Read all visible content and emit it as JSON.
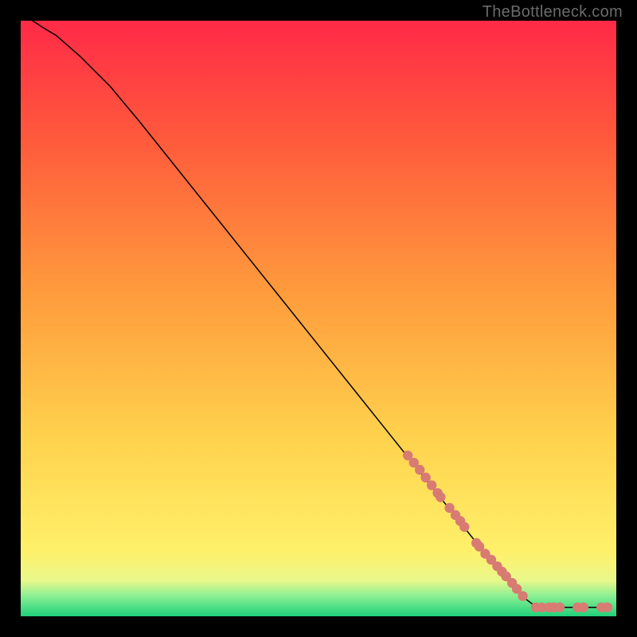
{
  "watermark": "TheBottleneck.com",
  "chart_data": {
    "type": "scatter",
    "title": "",
    "xlabel": "",
    "ylabel": "",
    "xlim": [
      0,
      100
    ],
    "ylim": [
      0,
      100
    ],
    "background_gradient": {
      "stops": [
        {
          "pct": 0.0,
          "color": "#1fd17b"
        },
        {
          "pct": 0.035,
          "color": "#8ef093"
        },
        {
          "pct": 0.06,
          "color": "#e9f88a"
        },
        {
          "pct": 0.11,
          "color": "#fff06a"
        },
        {
          "pct": 0.3,
          "color": "#ffd24d"
        },
        {
          "pct": 0.55,
          "color": "#ff9a3c"
        },
        {
          "pct": 0.8,
          "color": "#ff5a3c"
        },
        {
          "pct": 1.0,
          "color": "#ff2a47"
        }
      ]
    },
    "series": [
      {
        "name": "curve",
        "kind": "line",
        "color": "#000000",
        "width": 1.5,
        "points": [
          {
            "x": 2.0,
            "y": 100.0
          },
          {
            "x": 3.5,
            "y": 99.0
          },
          {
            "x": 6.0,
            "y": 97.5
          },
          {
            "x": 10.0,
            "y": 94.0
          },
          {
            "x": 15.0,
            "y": 89.0
          },
          {
            "x": 20.0,
            "y": 83.0
          },
          {
            "x": 30.0,
            "y": 70.5
          },
          {
            "x": 40.0,
            "y": 58.0
          },
          {
            "x": 50.0,
            "y": 45.5
          },
          {
            "x": 60.0,
            "y": 33.0
          },
          {
            "x": 70.0,
            "y": 20.5
          },
          {
            "x": 78.0,
            "y": 10.5
          },
          {
            "x": 84.0,
            "y": 3.5
          },
          {
            "x": 86.0,
            "y": 2.0
          },
          {
            "x": 88.0,
            "y": 1.5
          },
          {
            "x": 92.0,
            "y": 1.5
          },
          {
            "x": 96.0,
            "y": 1.5
          },
          {
            "x": 99.0,
            "y": 1.5
          }
        ]
      },
      {
        "name": "markers",
        "kind": "scatter",
        "color": "#d77b73",
        "radius": 6.2,
        "points": [
          {
            "x": 65.0,
            "y": 27.0
          },
          {
            "x": 66.0,
            "y": 25.8
          },
          {
            "x": 67.0,
            "y": 24.6
          },
          {
            "x": 68.0,
            "y": 23.3
          },
          {
            "x": 69.0,
            "y": 22.0
          },
          {
            "x": 70.0,
            "y": 20.7
          },
          {
            "x": 70.5,
            "y": 20.0
          },
          {
            "x": 72.0,
            "y": 18.2
          },
          {
            "x": 73.0,
            "y": 17.0
          },
          {
            "x": 73.8,
            "y": 16.0
          },
          {
            "x": 74.5,
            "y": 15.0
          },
          {
            "x": 76.5,
            "y": 12.3
          },
          {
            "x": 77.0,
            "y": 11.7
          },
          {
            "x": 78.0,
            "y": 10.5
          },
          {
            "x": 79.0,
            "y": 9.5
          },
          {
            "x": 80.0,
            "y": 8.4
          },
          {
            "x": 80.8,
            "y": 7.5
          },
          {
            "x": 81.5,
            "y": 6.7
          },
          {
            "x": 82.5,
            "y": 5.6
          },
          {
            "x": 83.3,
            "y": 4.6
          },
          {
            "x": 84.3,
            "y": 3.4
          },
          {
            "x": 86.5,
            "y": 1.5
          },
          {
            "x": 87.5,
            "y": 1.5
          },
          {
            "x": 88.7,
            "y": 1.5
          },
          {
            "x": 89.5,
            "y": 1.5
          },
          {
            "x": 90.5,
            "y": 1.5
          },
          {
            "x": 93.5,
            "y": 1.5
          },
          {
            "x": 94.5,
            "y": 1.5
          },
          {
            "x": 97.5,
            "y": 1.5
          },
          {
            "x": 98.5,
            "y": 1.5
          }
        ]
      }
    ]
  }
}
